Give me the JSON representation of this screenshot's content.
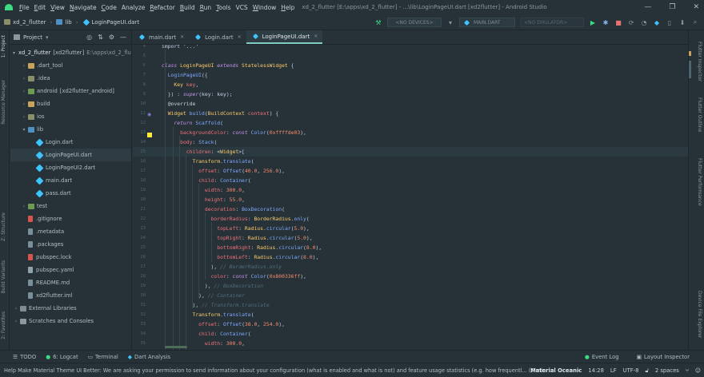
{
  "window": {
    "title": "xd_2_flutter [E:\\apps\\xd_2_flutter] - ...\\lib\\LoginPageUI.dart [xd2flutter] - Android Studio",
    "controls": [
      "—",
      "❐",
      "✕"
    ]
  },
  "menu": [
    {
      "label": "File",
      "mnemonic": "F",
      "rest": "ile"
    },
    {
      "label": "Edit",
      "mnemonic": "E",
      "rest": "dit"
    },
    {
      "label": "View",
      "mnemonic": "V",
      "rest": "iew"
    },
    {
      "label": "Navigate",
      "mnemonic": "N",
      "rest": "avigate"
    },
    {
      "label": "Code",
      "mnemonic": "C",
      "rest": "ode"
    },
    {
      "label": "Analyze",
      "mnemonic": "",
      "rest": "Analyze"
    },
    {
      "label": "Refactor",
      "mnemonic": "R",
      "rest": "efactor"
    },
    {
      "label": "Build",
      "mnemonic": "B",
      "rest": "uild"
    },
    {
      "label": "Run",
      "mnemonic": "R",
      "rest": "un"
    },
    {
      "label": "Tools",
      "mnemonic": "T",
      "rest": "ools"
    },
    {
      "label": "VCS",
      "mnemonic": "",
      "rest": "VCS"
    },
    {
      "label": "Window",
      "mnemonic": "W",
      "rest": "indow"
    },
    {
      "label": "Help",
      "mnemonic": "H",
      "rest": "elp"
    }
  ],
  "breadcrumbs": [
    "xd_2_flutter",
    "lib",
    "LoginPageUI.dart"
  ],
  "toolbar": {
    "device_dropdown": "<NO DEVICES>",
    "run_config": "MAIN.DART",
    "emulator_dropdown": "<NO EMULATOR>"
  },
  "left_tabs": [
    "1: Project",
    "Resource Manager",
    "Z: Structure",
    "Build Variants",
    "2: Favorites"
  ],
  "right_tabs": [
    "Flutter Inspector",
    "Flutter Outline",
    "Flutter Performance",
    "Device File Explorer"
  ],
  "project": {
    "header": "Project",
    "tree": [
      {
        "label": "xd_2_flutter",
        "extra": "[xd2flutter]",
        "path": "E:\\apps\\xd_2_flutter",
        "depth": 0,
        "arrow": "▾",
        "kind": "folder"
      },
      {
        "label": ".dart_tool",
        "extra": "",
        "path": "",
        "depth": 1,
        "arrow": "›",
        "kind": "folder-orange"
      },
      {
        "label": ".idea",
        "extra": "",
        "path": "",
        "depth": 1,
        "arrow": "›",
        "kind": "folder"
      },
      {
        "label": "android",
        "extra": "[xd2flutter_android]",
        "path": "",
        "depth": 1,
        "arrow": "›",
        "kind": "folder-green"
      },
      {
        "label": "build",
        "extra": "",
        "path": "",
        "depth": 1,
        "arrow": "›",
        "kind": "folder-orange"
      },
      {
        "label": "ios",
        "extra": "",
        "path": "",
        "depth": 1,
        "arrow": "›",
        "kind": "folder"
      },
      {
        "label": "lib",
        "extra": "",
        "path": "",
        "depth": 1,
        "arrow": "▾",
        "kind": "folder-blue"
      },
      {
        "label": "Login.dart",
        "extra": "",
        "path": "",
        "depth": 2,
        "arrow": "",
        "kind": "dart"
      },
      {
        "label": "LoginPageUI.dart",
        "extra": "",
        "path": "",
        "depth": 2,
        "arrow": "",
        "kind": "dart"
      },
      {
        "label": "LoginPageUI2.dart",
        "extra": "",
        "path": "",
        "depth": 2,
        "arrow": "",
        "kind": "dart"
      },
      {
        "label": "main.dart",
        "extra": "",
        "path": "",
        "depth": 2,
        "arrow": "",
        "kind": "dart"
      },
      {
        "label": "pass.dart",
        "extra": "",
        "path": "",
        "depth": 2,
        "arrow": "",
        "kind": "dart"
      },
      {
        "label": "test",
        "extra": "",
        "path": "",
        "depth": 1,
        "arrow": "›",
        "kind": "folder-green"
      },
      {
        "label": ".gitignore",
        "extra": "",
        "path": "",
        "depth": 1,
        "arrow": "",
        "kind": "file-red"
      },
      {
        "label": ".metadata",
        "extra": "",
        "path": "",
        "depth": 1,
        "arrow": "",
        "kind": "file-grey"
      },
      {
        "label": ".packages",
        "extra": "",
        "path": "",
        "depth": 1,
        "arrow": "",
        "kind": "file-grey"
      },
      {
        "label": "pubspec.lock",
        "extra": "",
        "path": "",
        "depth": 1,
        "arrow": "",
        "kind": "file-red"
      },
      {
        "label": "pubspec.yaml",
        "extra": "",
        "path": "",
        "depth": 1,
        "arrow": "",
        "kind": "file-yellow"
      },
      {
        "label": "README.md",
        "extra": "",
        "path": "",
        "depth": 1,
        "arrow": "",
        "kind": "file-grey"
      },
      {
        "label": "xd2flutter.iml",
        "extra": "",
        "path": "",
        "depth": 1,
        "arrow": "",
        "kind": "file-grey"
      },
      {
        "label": "External Libraries",
        "extra": "",
        "path": "",
        "depth": 0,
        "arrow": "›",
        "kind": "library"
      },
      {
        "label": "Scratches and Consoles",
        "extra": "",
        "path": "",
        "depth": 0,
        "arrow": "›",
        "kind": "scratch"
      }
    ]
  },
  "tabs": [
    {
      "label": "main.dart",
      "active": false
    },
    {
      "label": "Login.dart",
      "active": false
    },
    {
      "label": "LoginPageUI.dart",
      "active": true
    }
  ],
  "code": {
    "lines": [
      {
        "n": "4",
        "segs": [
          [
            "plain",
            "import '...'"
          ]
        ]
      },
      {
        "n": "5",
        "segs": []
      },
      {
        "n": "6",
        "segs": [
          [
            "kw",
            "class "
          ],
          [
            "cls",
            "LoginPageUI "
          ],
          [
            "kw",
            "extends "
          ],
          [
            "cls",
            "StatelessWidget "
          ],
          [
            "plain",
            "{"
          ]
        ]
      },
      {
        "n": "7",
        "segs": [
          [
            "plain",
            "  "
          ],
          [
            "fn",
            "LoginPageUI"
          ],
          [
            "plain",
            "({"
          ]
        ]
      },
      {
        "n": "8",
        "segs": [
          [
            "plain",
            "    "
          ],
          [
            "cls",
            "Key "
          ],
          [
            "prm",
            "key"
          ],
          [
            "plain",
            ","
          ]
        ]
      },
      {
        "n": "9",
        "segs": [
          [
            "plain",
            "  }) : "
          ],
          [
            "kw",
            "super"
          ],
          [
            "plain",
            "(key: key);"
          ]
        ]
      },
      {
        "n": "10",
        "segs": [
          [
            "plain",
            "  "
          ],
          [
            "ann",
            "@override"
          ]
        ]
      },
      {
        "n": "11",
        "segs": [
          [
            "plain",
            "  "
          ],
          [
            "cls",
            "Widget "
          ],
          [
            "fn",
            "build"
          ],
          [
            "plain",
            "("
          ],
          [
            "cls",
            "BuildContext "
          ],
          [
            "prm",
            "context"
          ],
          [
            "plain",
            ") {"
          ]
        ]
      },
      {
        "n": "12",
        "segs": [
          [
            "plain",
            "    "
          ],
          [
            "kw",
            "return "
          ],
          [
            "fn",
            "Scaffold"
          ],
          [
            "plain",
            "("
          ]
        ]
      },
      {
        "n": "13",
        "segs": [
          [
            "plain",
            "      "
          ],
          [
            "prm",
            "backgroundColor"
          ],
          [
            "plain",
            ": "
          ],
          [
            "kw",
            "const "
          ],
          [
            "fn",
            "Color"
          ],
          [
            "plain",
            "("
          ],
          [
            "num",
            "0xffffde03"
          ],
          [
            "plain",
            "),"
          ]
        ]
      },
      {
        "n": "14",
        "segs": [
          [
            "plain",
            "      "
          ],
          [
            "prm",
            "body"
          ],
          [
            "plain",
            ": "
          ],
          [
            "fn",
            "Stack"
          ],
          [
            "plain",
            "("
          ]
        ]
      },
      {
        "n": "15",
        "segs": [
          [
            "plain",
            "        "
          ],
          [
            "prm",
            "children"
          ],
          [
            "plain",
            ": <"
          ],
          [
            "cls",
            "Widget"
          ],
          [
            "plain",
            ">["
          ]
        ]
      },
      {
        "n": "16",
        "segs": [
          [
            "plain",
            "          "
          ],
          [
            "cls",
            "Transform"
          ],
          [
            "plain",
            "."
          ],
          [
            "fn",
            "translate"
          ],
          [
            "plain",
            "("
          ]
        ]
      },
      {
        "n": "17",
        "segs": [
          [
            "plain",
            "            "
          ],
          [
            "prm",
            "offset"
          ],
          [
            "plain",
            ": "
          ],
          [
            "fn",
            "Offset"
          ],
          [
            "plain",
            "("
          ],
          [
            "num",
            "40.0"
          ],
          [
            "plain",
            ", "
          ],
          [
            "num",
            "256.0"
          ],
          [
            "plain",
            "),"
          ]
        ]
      },
      {
        "n": "18",
        "segs": [
          [
            "plain",
            "            "
          ],
          [
            "prm",
            "child"
          ],
          [
            "plain",
            ": "
          ],
          [
            "fn",
            "Container"
          ],
          [
            "plain",
            "("
          ]
        ]
      },
      {
        "n": "19",
        "segs": [
          [
            "plain",
            "              "
          ],
          [
            "prm",
            "width"
          ],
          [
            "plain",
            ": "
          ],
          [
            "num",
            "300.0"
          ],
          [
            "plain",
            ","
          ]
        ]
      },
      {
        "n": "20",
        "segs": [
          [
            "plain",
            "              "
          ],
          [
            "prm",
            "height"
          ],
          [
            "plain",
            ": "
          ],
          [
            "num",
            "55.0"
          ],
          [
            "plain",
            ","
          ]
        ]
      },
      {
        "n": "21",
        "segs": [
          [
            "plain",
            "              "
          ],
          [
            "prm",
            "decoration"
          ],
          [
            "plain",
            ": "
          ],
          [
            "fn",
            "BoxDecoration"
          ],
          [
            "plain",
            "("
          ]
        ]
      },
      {
        "n": "22",
        "segs": [
          [
            "plain",
            "                "
          ],
          [
            "prm",
            "borderRadius"
          ],
          [
            "plain",
            ": "
          ],
          [
            "cls",
            "BorderRadius"
          ],
          [
            "plain",
            "."
          ],
          [
            "fn",
            "only"
          ],
          [
            "plain",
            "("
          ]
        ]
      },
      {
        "n": "23",
        "segs": [
          [
            "plain",
            "                  "
          ],
          [
            "prm",
            "topLeft"
          ],
          [
            "plain",
            ": "
          ],
          [
            "cls",
            "Radius"
          ],
          [
            "plain",
            "."
          ],
          [
            "fn",
            "circular"
          ],
          [
            "plain",
            "("
          ],
          [
            "num",
            "5.0"
          ],
          [
            "plain",
            "),"
          ]
        ]
      },
      {
        "n": "24",
        "segs": [
          [
            "plain",
            "                  "
          ],
          [
            "prm",
            "topRight"
          ],
          [
            "plain",
            ": "
          ],
          [
            "cls",
            "Radius"
          ],
          [
            "plain",
            "."
          ],
          [
            "fn",
            "circular"
          ],
          [
            "plain",
            "("
          ],
          [
            "num",
            "5.0"
          ],
          [
            "plain",
            "),"
          ]
        ]
      },
      {
        "n": "25",
        "segs": [
          [
            "plain",
            "                  "
          ],
          [
            "prm",
            "bottomRight"
          ],
          [
            "plain",
            ": "
          ],
          [
            "cls",
            "Radius"
          ],
          [
            "plain",
            "."
          ],
          [
            "fn",
            "circular"
          ],
          [
            "plain",
            "("
          ],
          [
            "num",
            "8.0"
          ],
          [
            "plain",
            "),"
          ]
        ]
      },
      {
        "n": "26",
        "segs": [
          [
            "plain",
            "                  "
          ],
          [
            "prm",
            "bottomLeft"
          ],
          [
            "plain",
            ": "
          ],
          [
            "cls",
            "Radius"
          ],
          [
            "plain",
            "."
          ],
          [
            "fn",
            "circular"
          ],
          [
            "plain",
            "("
          ],
          [
            "num",
            "8.0"
          ],
          [
            "plain",
            "),"
          ]
        ]
      },
      {
        "n": "27",
        "segs": [
          [
            "plain",
            "                ), "
          ],
          [
            "cmt",
            "// BorderRadius.only"
          ]
        ]
      },
      {
        "n": "28",
        "segs": [
          [
            "plain",
            "                "
          ],
          [
            "prm",
            "color"
          ],
          [
            "plain",
            ": "
          ],
          [
            "kw",
            "const "
          ],
          [
            "fn",
            "Color"
          ],
          [
            "plain",
            "("
          ],
          [
            "num",
            "0x800336ff"
          ],
          [
            "plain",
            "),"
          ]
        ]
      },
      {
        "n": "29",
        "segs": [
          [
            "plain",
            "              ), "
          ],
          [
            "cmt",
            "// BoxDecoration"
          ]
        ]
      },
      {
        "n": "30",
        "segs": [
          [
            "plain",
            "            ), "
          ],
          [
            "cmt",
            "// Container"
          ]
        ]
      },
      {
        "n": "31",
        "segs": [
          [
            "plain",
            "          ), "
          ],
          [
            "cmt",
            "// Transform.translate"
          ]
        ]
      },
      {
        "n": "32",
        "segs": [
          [
            "plain",
            "          "
          ],
          [
            "cls",
            "Transform"
          ],
          [
            "plain",
            "."
          ],
          [
            "fn",
            "translate"
          ],
          [
            "plain",
            "("
          ]
        ]
      },
      {
        "n": "33",
        "segs": [
          [
            "plain",
            "            "
          ],
          [
            "prm",
            "offset"
          ],
          [
            "plain",
            ": "
          ],
          [
            "fn",
            "Offset"
          ],
          [
            "plain",
            "("
          ],
          [
            "num",
            "38.0"
          ],
          [
            "plain",
            ", "
          ],
          [
            "num",
            "254.0"
          ],
          [
            "plain",
            "),"
          ]
        ]
      },
      {
        "n": "34",
        "segs": [
          [
            "plain",
            "            "
          ],
          [
            "prm",
            "child"
          ],
          [
            "plain",
            ": "
          ],
          [
            "fn",
            "Container"
          ],
          [
            "plain",
            "("
          ]
        ]
      },
      {
        "n": "35",
        "segs": [
          [
            "plain",
            "              "
          ],
          [
            "prm",
            "width"
          ],
          [
            "plain",
            ": "
          ],
          [
            "num",
            "300.0"
          ],
          [
            "plain",
            ","
          ]
        ]
      }
    ]
  },
  "bottom_tools": [
    {
      "label": "TODO",
      "icon": "todo-icon"
    },
    {
      "label": "6: Logcat",
      "icon": "logcat-icon"
    },
    {
      "label": "Terminal",
      "icon": "terminal-icon"
    },
    {
      "label": "Dart Analysis",
      "icon": "dart-analysis-icon"
    }
  ],
  "bottom_right_tools": [
    {
      "label": "Event Log",
      "icon": "event-log-icon"
    },
    {
      "label": "Layout Inspector",
      "icon": "layout-inspector-icon"
    }
  ],
  "status": {
    "message": "Help Make Material Theme UI Better: We are asking your permission to send information about your configuration (what is enabled and what is not) and feature usage statistics (e.g. how frequentl... (5 minutes ago)",
    "theme": "Material Oceanic",
    "position": "14:28",
    "line_sep": "LF",
    "encoding": "UTF-8",
    "indent": "2 spaces"
  }
}
